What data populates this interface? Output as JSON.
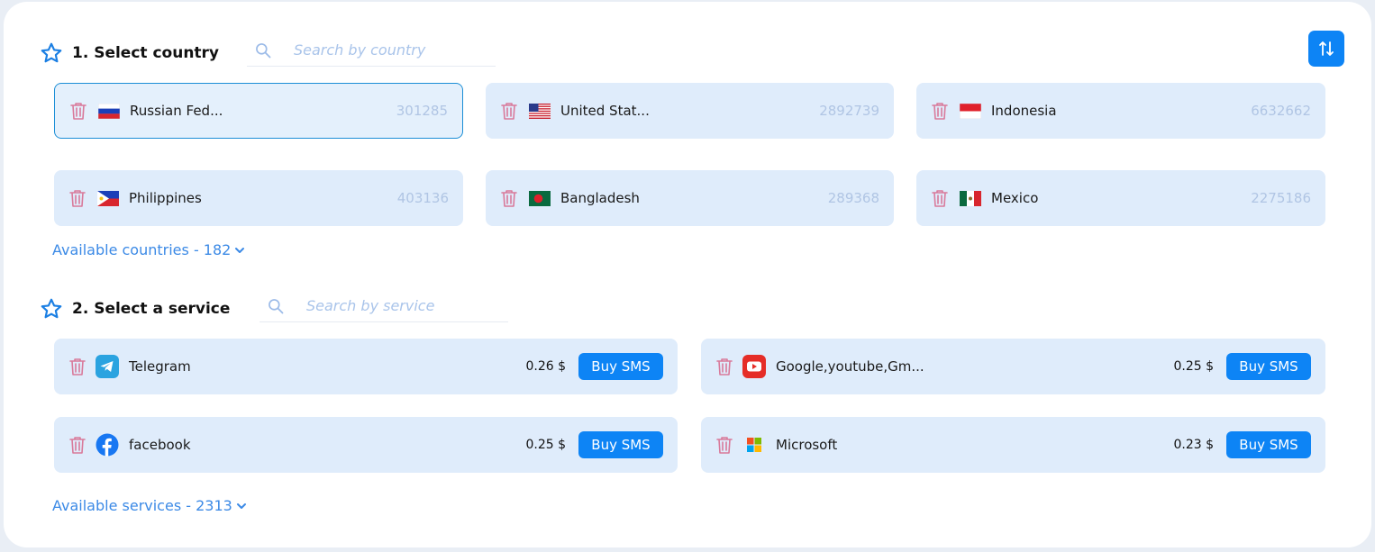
{
  "section1": {
    "title": "1. Select country",
    "search_placeholder": "Search by country",
    "available": "Available countries - 182"
  },
  "countries": [
    {
      "name": "Russian Fed...",
      "count": "301285",
      "flag": "russia"
    },
    {
      "name": "United Stat...",
      "count": "2892739",
      "flag": "usa"
    },
    {
      "name": "Indonesia",
      "count": "6632662",
      "flag": "indonesia"
    },
    {
      "name": "Philippines",
      "count": "403136",
      "flag": "philippines"
    },
    {
      "name": "Bangladesh",
      "count": "289368",
      "flag": "bangladesh"
    },
    {
      "name": "Mexico",
      "count": "2275186",
      "flag": "mexico"
    }
  ],
  "section2": {
    "title": "2. Select a service",
    "search_placeholder": "Search by service",
    "available": "Available services - 2313"
  },
  "services": [
    {
      "name": "Telegram",
      "price": "0.26 $",
      "buy": "Buy SMS",
      "icon": "telegram-icon"
    },
    {
      "name": "Google,youtube,Gm...",
      "price": "0.25 $",
      "buy": "Buy SMS",
      "icon": "youtube-icon"
    },
    {
      "name": "facebook",
      "price": "0.25 $",
      "buy": "Buy SMS",
      "icon": "facebook-icon"
    },
    {
      "name": "Microsoft",
      "price": "0.23 $",
      "buy": "Buy SMS",
      "icon": "microsoft-icon"
    }
  ],
  "colors": {
    "accent": "#0d84f5",
    "card": "#dfecfb",
    "trash": "#d9799a",
    "count": "#b0c5e4"
  }
}
